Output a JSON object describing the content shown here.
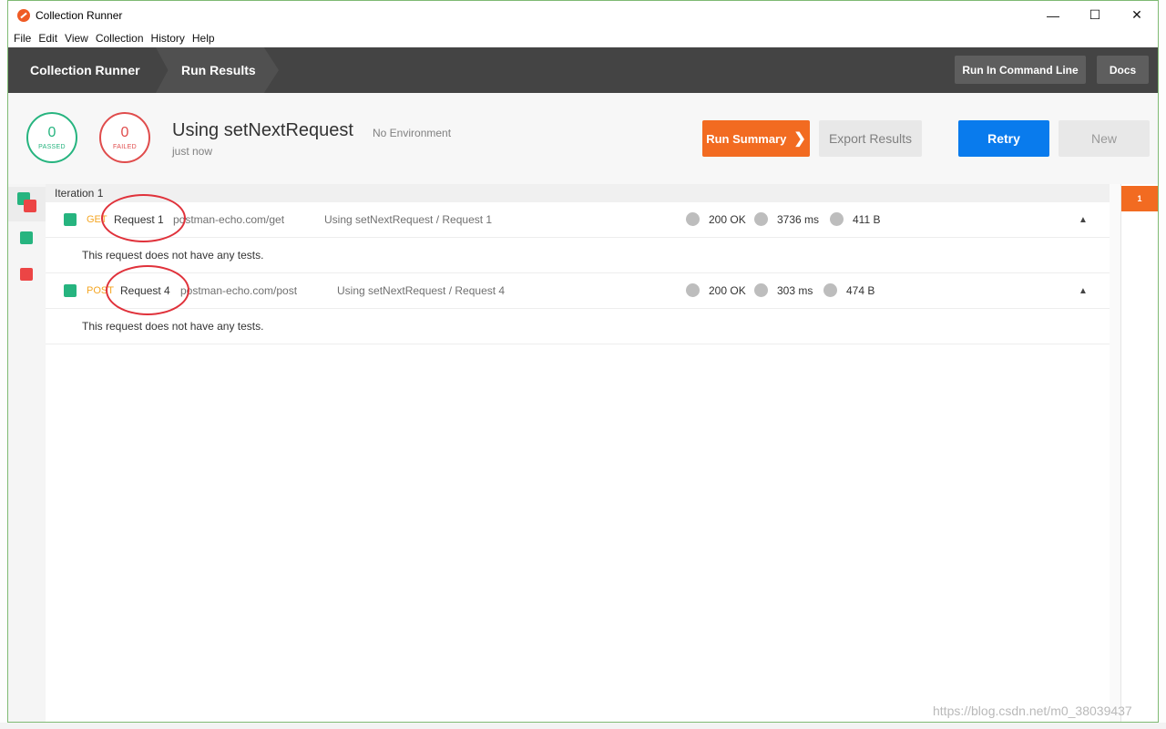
{
  "window": {
    "title": "Collection Runner"
  },
  "menu": [
    "File",
    "Edit",
    "View",
    "Collection",
    "History",
    "Help"
  ],
  "header": {
    "crumb_runner": "Collection Runner",
    "crumb_results": "Run Results",
    "run_cli_label": "Run In Command Line",
    "docs_label": "Docs"
  },
  "summary": {
    "passed_count": "0",
    "passed_label": "PASSED",
    "failed_count": "0",
    "failed_label": "FAILED",
    "run_name": "Using setNextRequest",
    "environment": "No Environment",
    "time_ago": "just now",
    "run_summary_label": "Run Summary",
    "export_label": "Export Results",
    "retry_label": "Retry",
    "new_label": "New"
  },
  "iteration": {
    "label": "Iteration 1",
    "tab_number": "1",
    "requests": [
      {
        "method": "GET",
        "name": "Request 1",
        "url": "postman-echo.com/get",
        "path": "Using setNextRequest / Request 1",
        "status": "200 OK",
        "time": "3736 ms",
        "size": "411 B",
        "tests_message": "This request does not have any tests."
      },
      {
        "method": "POST",
        "name": "Request 4",
        "url": "postman-echo.com/post",
        "path": "Using setNextRequest / Request 4",
        "status": "200 OK",
        "time": "303 ms",
        "size": "474 B",
        "tests_message": "This request does not have any tests."
      }
    ]
  },
  "colors": {
    "passed": "#26b47f",
    "failed": "#e04c4c",
    "accent_orange": "#f26b21",
    "primary_blue": "#097bed",
    "header_bg": "#444444",
    "annotation_red": "#e0323b"
  },
  "watermark": "https://blog.csdn.net/m0_38039437"
}
